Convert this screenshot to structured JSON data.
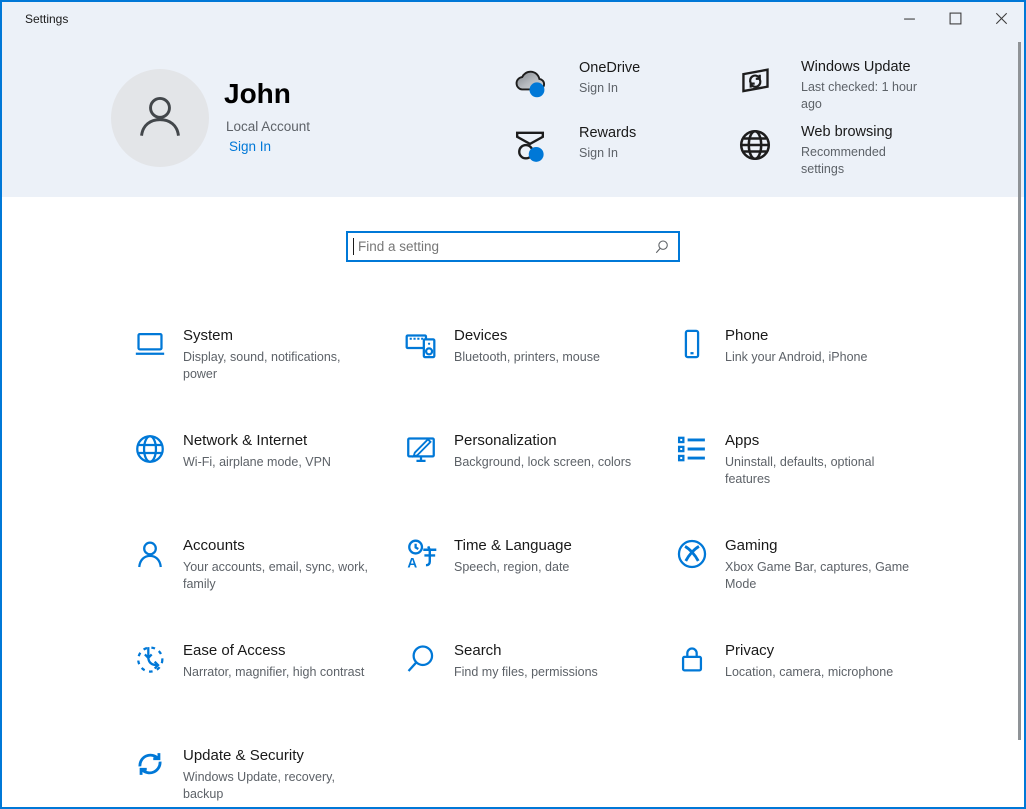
{
  "titlebar": {
    "title": "Settings"
  },
  "window_controls": [
    "minimize-icon",
    "maximize-icon",
    "close-icon"
  ],
  "header": {
    "user": {
      "name": "John",
      "account_type": "Local Account",
      "sign_in_label": "Sign In"
    },
    "quick": [
      {
        "id": "onedrive",
        "title": "OneDrive",
        "subtitle": "Sign In",
        "icon": "onedrive-cloud-icon"
      },
      {
        "id": "windows-update",
        "title": "Windows Update",
        "subtitle": "Last checked: 1 hour ago",
        "icon": "windows-update-icon"
      },
      {
        "id": "rewards",
        "title": "Rewards",
        "subtitle": "Sign In",
        "icon": "rewards-medal-icon"
      },
      {
        "id": "web-browsing",
        "title": "Web browsing",
        "subtitle": "Recommended settings",
        "icon": "web-globe-icon"
      }
    ]
  },
  "search": {
    "placeholder": "Find a setting",
    "icon": "search-icon"
  },
  "categories": [
    {
      "id": "system",
      "title": "System",
      "subtitle": "Display, sound, notifications, power",
      "icon": "laptop-icon"
    },
    {
      "id": "devices",
      "title": "Devices",
      "subtitle": "Bluetooth, printers, mouse",
      "icon": "keyboard-speaker-icon"
    },
    {
      "id": "phone",
      "title": "Phone",
      "subtitle": "Link your Android, iPhone",
      "icon": "phone-icon"
    },
    {
      "id": "network",
      "title": "Network & Internet",
      "subtitle": "Wi-Fi, airplane mode, VPN",
      "icon": "network-globe-icon"
    },
    {
      "id": "personalization",
      "title": "Personalization",
      "subtitle": "Background, lock screen, colors",
      "icon": "display-pen-icon"
    },
    {
      "id": "apps",
      "title": "Apps",
      "subtitle": "Uninstall, defaults, optional features",
      "icon": "apps-list-icon"
    },
    {
      "id": "accounts",
      "title": "Accounts",
      "subtitle": "Your accounts, email, sync, work, family",
      "icon": "person-icon"
    },
    {
      "id": "time-language",
      "title": "Time & Language",
      "subtitle": "Speech, region, date",
      "icon": "clock-language-icon"
    },
    {
      "id": "gaming",
      "title": "Gaming",
      "subtitle": "Xbox Game Bar, captures, Game Mode",
      "icon": "xbox-icon"
    },
    {
      "id": "ease-of-access",
      "title": "Ease of Access",
      "subtitle": "Narrator, magnifier, high contrast",
      "icon": "ease-of-access-icon"
    },
    {
      "id": "search",
      "title": "Search",
      "subtitle": "Find my files, permissions",
      "icon": "magnifier-icon"
    },
    {
      "id": "privacy",
      "title": "Privacy",
      "subtitle": "Location, camera, microphone",
      "icon": "lock-icon"
    },
    {
      "id": "update-security",
      "title": "Update & Security",
      "subtitle": "Windows Update, recovery, backup",
      "icon": "sync-arrows-icon"
    }
  ],
  "colors": {
    "accent": "#0078d7",
    "header_bg": "#ecf1f8",
    "title_text": "#191919",
    "secondary_text": "#5d6268",
    "category_icon_blue": "#0078d7"
  }
}
